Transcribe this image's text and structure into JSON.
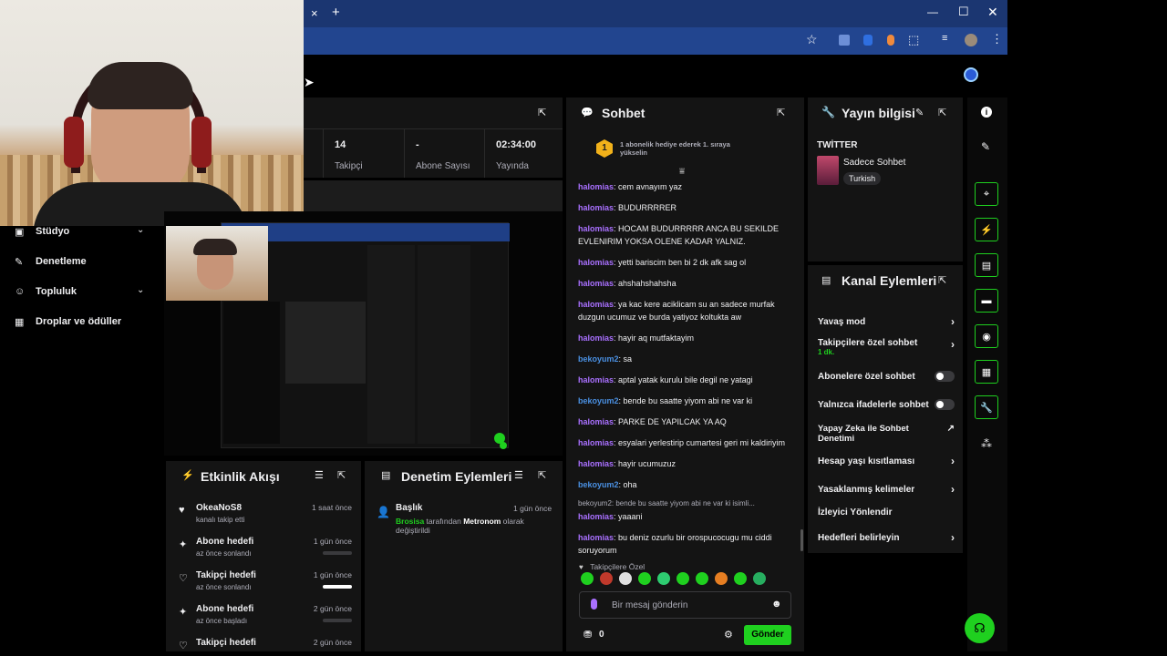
{
  "browser": {
    "new_tab": "+",
    "tab_close": "×",
    "window_controls": [
      "—",
      "☐",
      "✕"
    ]
  },
  "stats": {
    "followers_value": "14",
    "followers_label": "Takipçi",
    "subs_value": "-",
    "subs_label": "Abone Sayısı",
    "live_value": "02:34:00",
    "live_label": "Yayında"
  },
  "sidebar": {
    "items": [
      {
        "label": "Stüdyo",
        "icon": "studio-icon",
        "chevron": true
      },
      {
        "label": "Denetleme",
        "icon": "wrench-icon",
        "chevron": false
      },
      {
        "label": "Topluluk",
        "icon": "community-icon",
        "chevron": true
      },
      {
        "label": "Droplar ve ödüller",
        "icon": "drops-icon",
        "chevron": false
      }
    ]
  },
  "chat": {
    "title": "Sohbet",
    "hype": "1 abonelik hediye ederek 1. sıraya yükselin",
    "hype_rank": "1",
    "messages": [
      {
        "user": "halomias",
        "text": ": cem avnayım yaz",
        "color": "purple"
      },
      {
        "user": "halomias",
        "text": ": BUDURRRRER",
        "color": "purple"
      },
      {
        "user": "halomias",
        "text": ": HOCAM BUDURRRRR ANCA BU SEKILDE EVLENIRIM YOKSA OLENE KADAR YALNIZ.",
        "color": "purple"
      },
      {
        "user": "halomias",
        "text": ": yetti bariscim ben bi 2 dk afk sag ol",
        "color": "purple"
      },
      {
        "user": "halomias",
        "text": ": ahshahshahsha",
        "color": "purple"
      },
      {
        "user": "halomias",
        "text": ": ya kac kere aciklicam su an sadece murfak duzgun ucumuz ve burda yatiyoz koltukta aw",
        "color": "purple"
      },
      {
        "user": "halomias",
        "text": ": hayir aq mutfaktayim",
        "color": "purple"
      },
      {
        "user": "bekoyum2",
        "text": ": sa",
        "color": "blue"
      },
      {
        "user": "halomias",
        "text": ": aptal yatak kurulu bile degil ne yatagi",
        "color": "purple"
      },
      {
        "user": "bekoyum2",
        "text": ": bende bu saatte yiyom abi ne var ki",
        "color": "blue"
      },
      {
        "user": "halomias",
        "text": ": PARKE DE YAPILCAK YA AQ",
        "color": "purple"
      },
      {
        "user": "halomias",
        "text": ": esyalari yerlestirip cumartesi geri mi kaldiriyim",
        "color": "purple"
      },
      {
        "user": "halomias",
        "text": ": hayir ucumuzuz",
        "color": "purple"
      },
      {
        "user": "bekoyum2",
        "text": ": oha",
        "color": "blue"
      }
    ],
    "reply_preview": "bekoyum2: bende bu saatte yiyom abi ne var ki isimli...",
    "reply_messages": [
      {
        "user": "halomias",
        "text": ": yaaani",
        "color": "purple"
      },
      {
        "user": "halomias",
        "text": ": bu deniz ozurlu bir orospucocugu mu ciddi soruyorum",
        "color": "purple"
      }
    ],
    "followers_only_label": "Takipçilere Özel",
    "input_placeholder": "Bir mesaj gönderin",
    "points": "0",
    "send_label": "Gönder"
  },
  "stream_info": {
    "title": "Yayın bilgisi",
    "tag_title": "TWİTTER",
    "stream_name": "Sadece Sohbet",
    "language": "Turkish"
  },
  "channel_actions": {
    "title": "Kanal Eylemleri",
    "items": [
      {
        "label": "Yavaş mod",
        "sub": "",
        "control": "chevron"
      },
      {
        "label": "Takipçilere özel sohbet",
        "sub": "1 dk.",
        "control": "chevron"
      },
      {
        "label": "Abonelere özel sohbet",
        "sub": "",
        "control": "toggle"
      },
      {
        "label": "Yalnızca ifadelerle sohbet",
        "sub": "",
        "control": "toggle"
      },
      {
        "label": "Yapay Zeka ile Sohbet Denetimi",
        "sub": "",
        "control": "external"
      },
      {
        "label": "Hesap yaşı kısıtlaması",
        "sub": "",
        "control": "chevron"
      },
      {
        "label": "Yasaklanmış kelimeler",
        "sub": "",
        "control": "chevron"
      },
      {
        "label": "İzleyici Yönlendir",
        "sub": "",
        "control": "none"
      },
      {
        "label": "Hedefleri belirleyin",
        "sub": "",
        "control": "chevron"
      }
    ]
  },
  "activity": {
    "title": "Etkinlik Akışı",
    "items": [
      {
        "icon": "heart-filled-icon",
        "title": "OkeaNoS8",
        "sub": "kanalı takip etti",
        "time": "1 saat önce",
        "bar": false,
        "bar_fill": 0
      },
      {
        "icon": "sparkle-icon",
        "title": "Abone hedefi",
        "sub": "az önce sonlandı",
        "time": "1 gün önce",
        "bar": true,
        "bar_fill": 0
      },
      {
        "icon": "heart-outline-icon",
        "title": "Takipçi hedefi",
        "sub": "az önce sonlandı",
        "time": "1 gün önce",
        "bar": true,
        "bar_fill": 1
      },
      {
        "icon": "sparkle-icon",
        "title": "Abone hedefi",
        "sub": "az önce başladı",
        "time": "2 gün önce",
        "bar": true,
        "bar_fill": 0
      },
      {
        "icon": "heart-outline-icon",
        "title": "Takipçi hedefi",
        "sub": "",
        "time": "2 gün önce",
        "bar": false,
        "bar_fill": 0
      }
    ]
  },
  "mod_actions": {
    "title": "Denetim Eylemleri",
    "item_title": "Başlık",
    "item_time": "1 gün önce",
    "actor": "Brosisa",
    "mid": " tarafından ",
    "target": "Metronom",
    "tail": " olarak değiştirildi"
  },
  "colors": {
    "accent_green": "#1fd01f",
    "chat_purple": "#a970ff",
    "chat_blue": "#4a90e2",
    "panel_bg": "#141414",
    "chrome_blue": "#1d3b7a"
  }
}
